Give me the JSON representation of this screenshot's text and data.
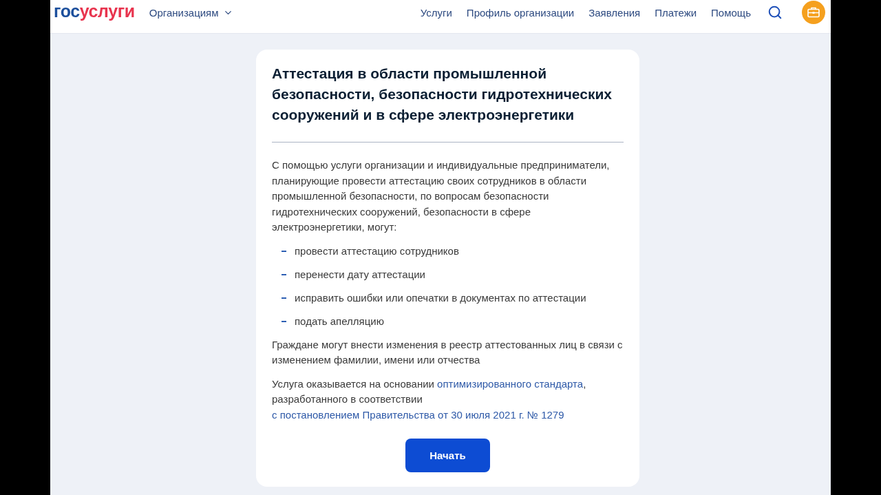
{
  "header": {
    "logo": {
      "prefix": "гос",
      "suffix": "услуги"
    },
    "org_menu": {
      "label": "Организациям",
      "expanded": false
    },
    "nav": [
      {
        "label": "Услуги"
      },
      {
        "label": "Профиль организации"
      },
      {
        "label": "Заявления"
      },
      {
        "label": "Платежи"
      },
      {
        "label": "Помощь"
      }
    ]
  },
  "card": {
    "title": "Аттестация в области промышленной безопасности, безопасности гидротехнических сооружений и в сфере электроэнергетики",
    "intro": "С помощью услуги организации и индивидуальные предприниматели, планирующие провести аттестацию своих сотрудников в области промышленной безопасности, по вопросам безопасности гидротехнических сооружений, безопасности в сфере электроэнергетики, могут:",
    "actions": [
      "провести аттестацию сотрудников",
      "перенести дату аттестации",
      "исправить ошибки или опечатки в документах по аттестации",
      "подать апелляцию"
    ],
    "citizens_note": "Граждане могут внести изменения в реестр аттестованных лиц в связи с изменением фамилии, имени или отчества",
    "basis": [
      {
        "kind": "text",
        "text": "Услуга оказывается на основании "
      },
      {
        "kind": "link",
        "text": "оптимизированного стандарта"
      },
      {
        "kind": "text",
        "text": ", разработанного в соответствии "
      },
      {
        "kind": "link",
        "text": "с постановлением Правительства от 30 июля 2021 г. № 1279"
      }
    ],
    "button": "Начать"
  }
}
